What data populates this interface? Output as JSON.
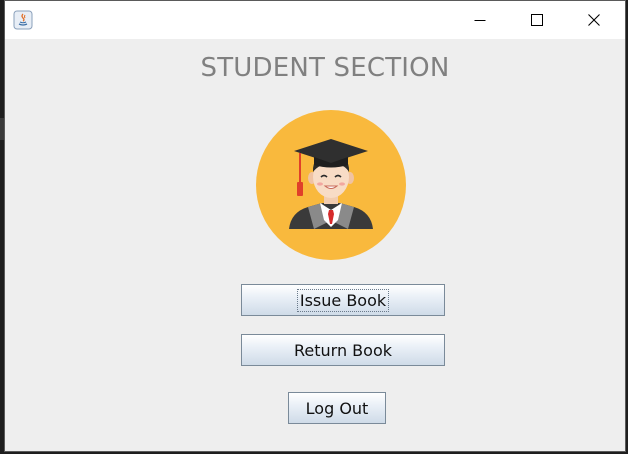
{
  "window": {
    "title": "",
    "controls": {
      "minimize_icon": "minimize-icon",
      "maximize_icon": "maximize-icon",
      "close_icon": "close-icon"
    }
  },
  "main": {
    "heading": "STUDENT SECTION",
    "avatar_icon": "graduate-student-icon",
    "buttons": {
      "issue_book": "Issue Book",
      "return_book": "Return Book",
      "log_out": "Log Out"
    }
  },
  "colors": {
    "avatar_background": "#f9b93d",
    "heading_text": "#808080",
    "window_background": "#eeeeee"
  }
}
